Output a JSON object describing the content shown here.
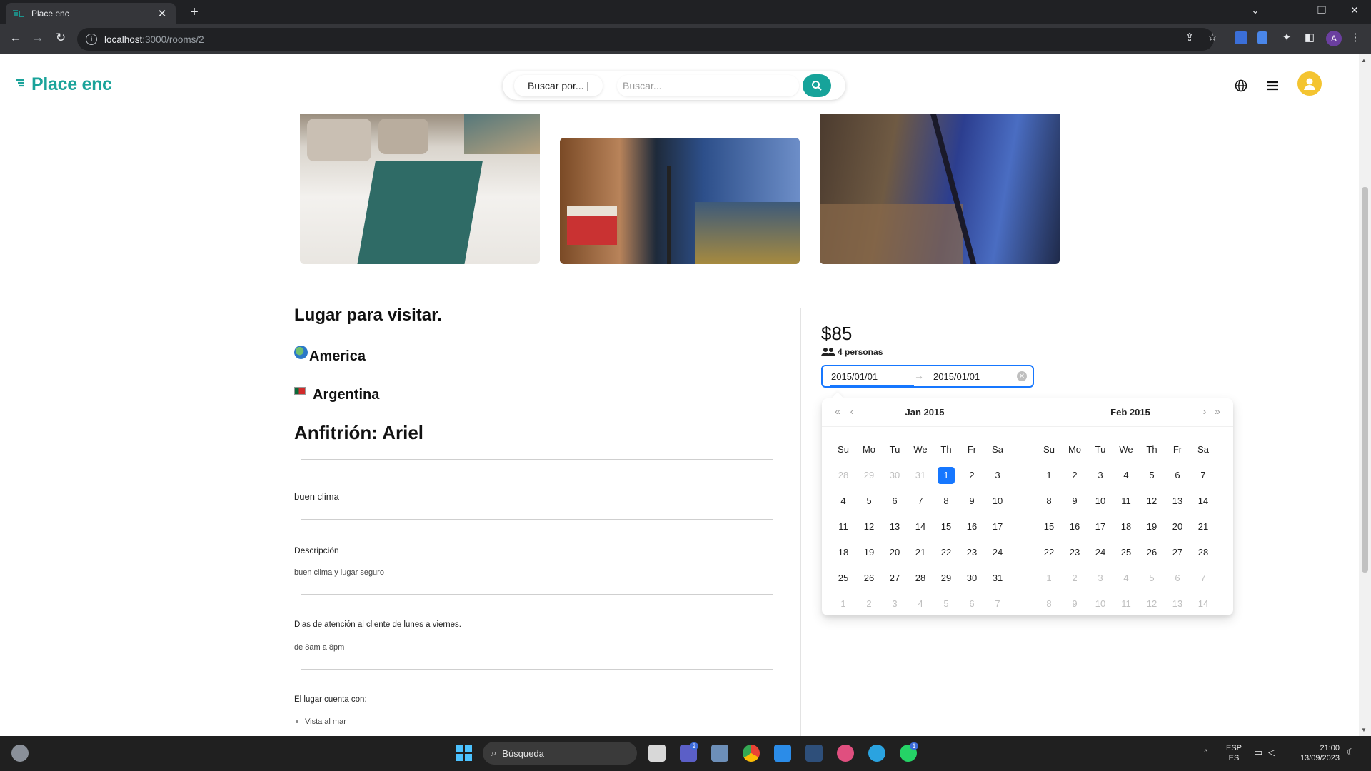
{
  "browser": {
    "tab_title": "Place enc",
    "tab_close": "✕",
    "new_tab": "+",
    "url_host": "localhost",
    "url_path": ":3000/rooms/2"
  },
  "header": {
    "logo": "Place enc",
    "search_category": "Buscar por... |",
    "search_placeholder": "Buscar..."
  },
  "listing": {
    "title": "Lugar para visitar.",
    "continent": "America",
    "country": "Argentina",
    "host": "Anfitrión: Ariel",
    "short_desc": "buen clima",
    "desc_label": "Descripción",
    "desc_text": "buen clima y lugar seguro",
    "service_label": "Dias de atención al cliente de lunes a viernes.",
    "service_hours": "de 8am a 8pm",
    "amenities_label": "El lugar cuenta con:",
    "amenities": [
      "Vista al mar"
    ]
  },
  "booking": {
    "price": "$85",
    "guests": "4 personas",
    "start_date": "2015/01/01",
    "end_date": "2015/01/01",
    "separator": "→"
  },
  "calendar": {
    "weekdays": [
      "Su",
      "Mo",
      "Tu",
      "We",
      "Th",
      "Fr",
      "Sa"
    ],
    "months": [
      {
        "month": "Jan",
        "year": "2015",
        "days": [
          [
            "28",
            "29",
            "30",
            "31",
            "1",
            "2",
            "3"
          ],
          [
            "4",
            "5",
            "6",
            "7",
            "8",
            "9",
            "10"
          ],
          [
            "11",
            "12",
            "13",
            "14",
            "15",
            "16",
            "17"
          ],
          [
            "18",
            "19",
            "20",
            "21",
            "22",
            "23",
            "24"
          ],
          [
            "25",
            "26",
            "27",
            "28",
            "29",
            "30",
            "31"
          ],
          [
            "1",
            "2",
            "3",
            "4",
            "5",
            "6",
            "7"
          ]
        ],
        "muted_rows_leading": 4,
        "muted_last_row": true,
        "selected": [
          0,
          4
        ]
      },
      {
        "month": "Feb",
        "year": "2015",
        "days": [
          [
            "1",
            "2",
            "3",
            "4",
            "5",
            "6",
            "7"
          ],
          [
            "8",
            "9",
            "10",
            "11",
            "12",
            "13",
            "14"
          ],
          [
            "15",
            "16",
            "17",
            "18",
            "19",
            "20",
            "21"
          ],
          [
            "22",
            "23",
            "24",
            "25",
            "26",
            "27",
            "28"
          ],
          [
            "1",
            "2",
            "3",
            "4",
            "5",
            "6",
            "7"
          ],
          [
            "8",
            "9",
            "10",
            "11",
            "12",
            "13",
            "14"
          ]
        ],
        "muted_rows_leading": 0,
        "muted_from_row": 4
      }
    ]
  },
  "taskbar": {
    "search": "Búsqueda",
    "lang_top": "ESP",
    "lang_bottom": "ES",
    "time": "21:00",
    "date": "13/09/2023",
    "badge_teams": "2",
    "badge_whatsapp": "1"
  }
}
